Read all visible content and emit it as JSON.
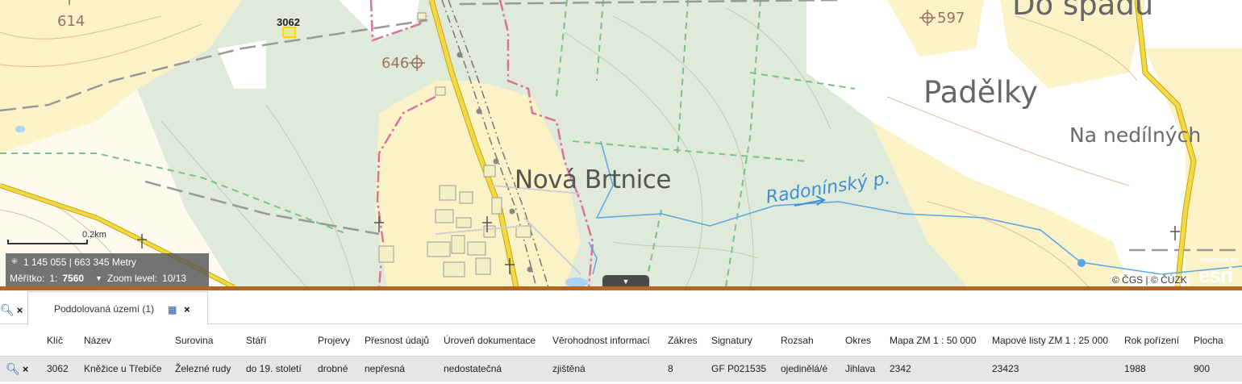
{
  "map": {
    "contour_labels": {
      "top_left": "614",
      "hill_646": "646",
      "hill_597": "597"
    },
    "place_names": {
      "town": "Nová Brtnice",
      "padelky": "Padělky",
      "do_spadu": "Do spádu",
      "na_nedilnych": "Na nedílných",
      "river": "Radonínský p."
    },
    "feature_label": "3062",
    "scale_bar_label": "0.2km",
    "coordinates": "1 145 055 | 663 345 Metry",
    "scale_label": "Měřítko:",
    "scale_prefix": "1:",
    "scale_value": "7560",
    "zoom_label": "Zoom level:",
    "zoom_value": "10/13",
    "attribution": "© ČGS | © ČÚZK",
    "esri_small": "POWERED BY",
    "esri_big": "esri"
  },
  "panel": {
    "tab_label": "Poddolovaná území (1)",
    "columns": [
      "Klíč",
      "Název",
      "Surovina",
      "Stáří",
      "Projevy",
      "Přesnost údajů",
      "Úroveň dokumentace",
      "Věrohodnost informací",
      "Zákres",
      "Signatury",
      "Rozsah",
      "Okres",
      "Mapa ZM 1 : 50 000",
      "Mapové listy ZM 1 : 25 000",
      "Rok pořízení",
      "Plocha"
    ],
    "rows": [
      [
        "3062",
        "Kněžice u Třebíče",
        "Železné rudy",
        "do 19. století",
        "drobné",
        "nepřesná",
        "nedostatečná",
        "zjištěná",
        "8",
        "GF P021535",
        "ojedinělá/é",
        "Jihlava",
        "2342",
        "23423",
        "1988",
        "900"
      ]
    ]
  },
  "colors": {
    "divider": "#b5651d",
    "row_bg": "#e6e6e6",
    "link_icon": "#1a5fb4",
    "road": "#f2d94a",
    "boundary": "#d9739a",
    "water": "#3f8fd4",
    "forest": "#dfeadb",
    "field": "#fbf2c8"
  },
  "icons": {
    "zoom": "magnifier-icon",
    "remove": "close-icon",
    "table": "table-icon",
    "collapse": "caret-down-icon",
    "coords": "crosshair-icon"
  }
}
